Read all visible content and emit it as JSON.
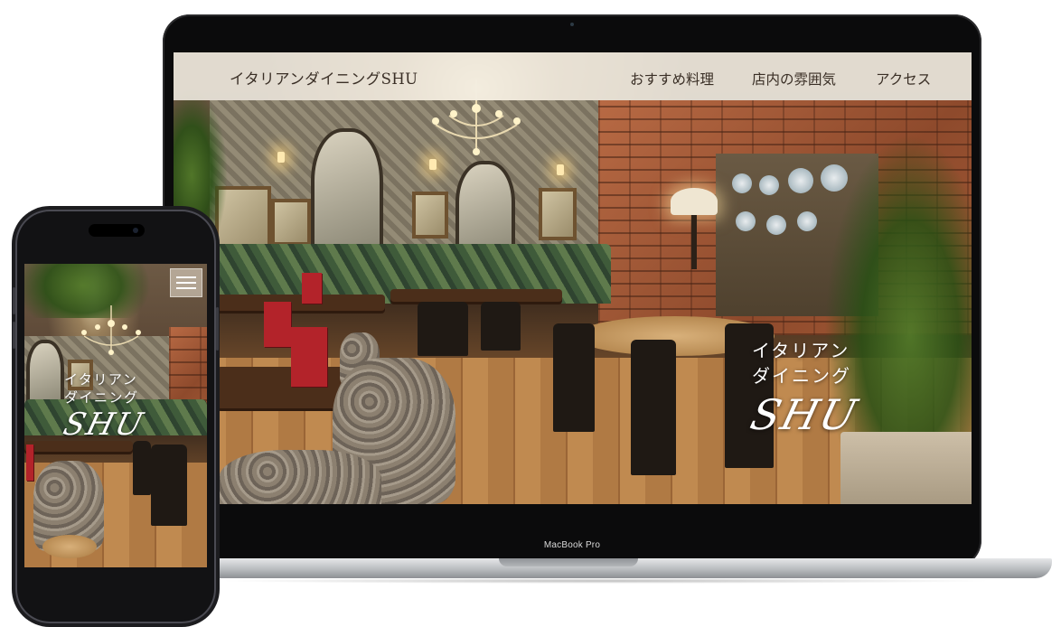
{
  "laptop": {
    "brand_label": "MacBook Pro"
  },
  "site": {
    "logo_text": "イタリアンダイニングSHU",
    "nav": [
      {
        "label": "おすすめ料理"
      },
      {
        "label": "店内の雰囲気"
      },
      {
        "label": "アクセス"
      }
    ],
    "hero": {
      "line1": "イタリアン",
      "line2": "ダイニング",
      "script": "SHU"
    }
  },
  "phone": {
    "menu_icon": "hamburger-menu-icon",
    "hero": {
      "line1": "イタリアン",
      "line2": "ダイニング",
      "script": "SHU"
    }
  },
  "colors": {
    "header_bg": "#f5f0e6",
    "header_text": "#3a2f26",
    "hero_text": "#ffffff",
    "device_bezel": "#0b0b0c"
  }
}
